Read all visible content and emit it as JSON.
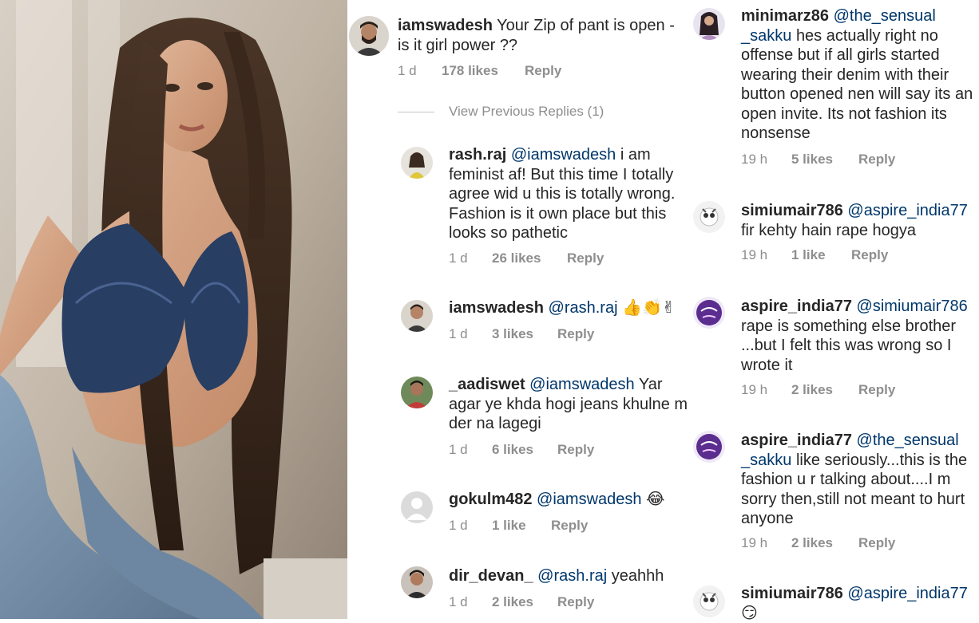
{
  "left_column": {
    "top": {
      "username": "iamswadesh",
      "text": "Your Zip of pant is open - is it girl power ??",
      "time": "1 d",
      "likes": "178 likes",
      "reply": "Reply"
    },
    "view_previous": "View Previous Replies (1)",
    "replies": [
      {
        "username": "rash.raj",
        "mention": "@iamswadesh",
        "text": "i am feminist af! But this time I totally agree wid u this is totally wrong. Fashion is it own place but this looks so pathetic",
        "time": "1 d",
        "likes": "26 likes",
        "reply": "Reply"
      },
      {
        "username": "iamswadesh",
        "mention": "@rash.raj",
        "text": "👍👏✌",
        "time": "1 d",
        "likes": "3 likes",
        "reply": "Reply"
      },
      {
        "username": "_aadiswet",
        "mention": "@iamswadesh",
        "text": "Yar agar ye khda hogi jeans khulne m der na lagegi",
        "time": "1 d",
        "likes": "6 likes",
        "reply": "Reply"
      },
      {
        "username": "gokulm482",
        "mention": "@iamswadesh",
        "text": "😂",
        "time": "1 d",
        "likes": "1 like",
        "reply": "Reply"
      },
      {
        "username": "dir_devan_",
        "mention": "@rash.raj",
        "text": "yeahhh",
        "time": "1 d",
        "likes": "2 likes",
        "reply": "Reply"
      }
    ]
  },
  "right_column": {
    "replies": [
      {
        "username": "minimarz86",
        "mention": "@the_sensual _sakku",
        "text": "hes actually right no offense but if all girls started wearing their denim with their button opened nen will say its an open invite. Its not fashion its nonsense",
        "time": "19 h",
        "likes": "5 likes",
        "reply": "Reply"
      },
      {
        "username": "simiumair786",
        "mention": "@aspire_india77",
        "text": "fir kehty hain rape hogya",
        "time": "19 h",
        "likes": "1 like",
        "reply": "Reply"
      },
      {
        "username": "aspire_india77",
        "mention": "@simiumair786",
        "text": "rape is something else brother ...but I felt this was wrong so I wrote it",
        "time": "19 h",
        "likes": "2 likes",
        "reply": "Reply"
      },
      {
        "username": "aspire_india77",
        "mention": "@the_sensual _sakku",
        "text": "like seriously...this is the fashion u r talking about....I m sorry then,still not meant to hurt anyone",
        "time": "19 h",
        "likes": "2 likes",
        "reply": "Reply"
      },
      {
        "username": "simiumair786",
        "mention": "@aspire_india77",
        "text": "😏",
        "time": "",
        "likes": "",
        "reply": ""
      }
    ]
  },
  "colors": {
    "text": "#262626",
    "meta": "#8e8e8e",
    "mention": "#00376b"
  }
}
